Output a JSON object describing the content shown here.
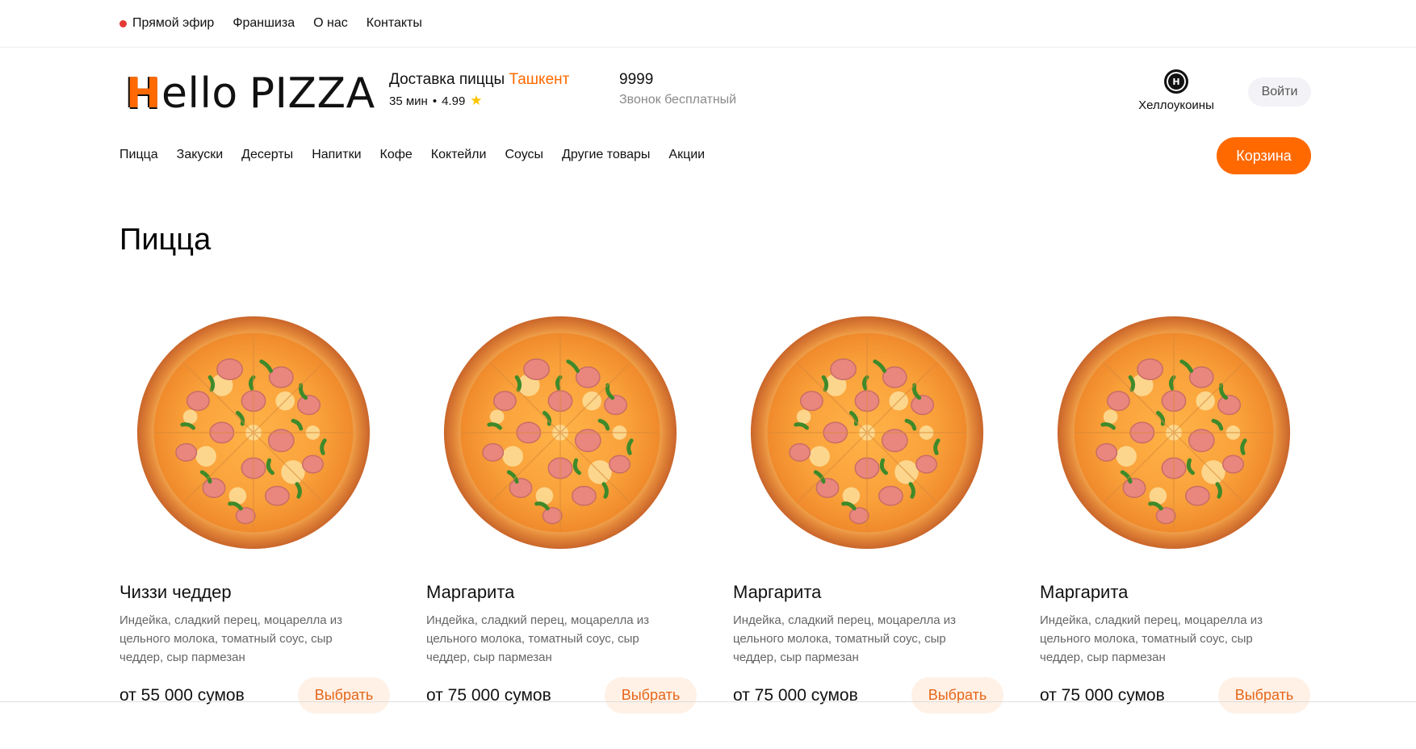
{
  "topbar": {
    "live": "Прямой эфир",
    "links": [
      "Франшиза",
      "О нас",
      "Контакты"
    ]
  },
  "header": {
    "logo_h": "H",
    "logo_rest": "ello",
    "logo_pizza": "PIZZA",
    "delivery_label": "Доставка пиццы",
    "city": "Ташкент",
    "delivery_time": "35 мин",
    "rating": "4.99",
    "phone": "9999",
    "phone_note": "Звонок бесплатный",
    "coins_label": "Хеллоукоины",
    "login": "Войти"
  },
  "nav": {
    "items": [
      "Пицца",
      "Закуски",
      "Десерты",
      "Напитки",
      "Кофе",
      "Коктейли",
      "Соусы",
      "Другие товары",
      "Акции"
    ],
    "cart": "Корзина"
  },
  "section": {
    "title": "Пицца"
  },
  "products": [
    {
      "name": "Чиззи чеддер",
      "description": "Индейка, сладкий перец, моцарелла из цельного молока, томатный соус, сыр чеддер, сыр пармезан",
      "price": "от 55 000 сумов",
      "button": "Выбрать"
    },
    {
      "name": "Маргарита",
      "description": "Индейка, сладкий перец, моцарелла из цельного молока, томатный соус, сыр чеддер, сыр пармезан",
      "price": "от 75 000 сумов",
      "button": "Выбрать"
    },
    {
      "name": "Маргарита",
      "description": "Индейка, сладкий перец, моцарелла из цельного молока, томатный соус, сыр чеддер, сыр пармезан",
      "price": "от 75 000 сумов",
      "button": "Выбрать"
    },
    {
      "name": "Маргарита",
      "description": "Индейка, сладкий перец, моцарелла из цельного молока, томатный соус, сыр чеддер, сыр пармезан",
      "price": "от 75 000 сумов",
      "button": "Выбрать"
    }
  ],
  "colors": {
    "accent": "#ff6900",
    "button_soft": "#fff1e6",
    "live_dot": "#e53935",
    "star": "#ffc400"
  },
  "icons": {
    "live": "red-dot-icon",
    "rating": "star-icon",
    "coins": "coin-icon"
  }
}
